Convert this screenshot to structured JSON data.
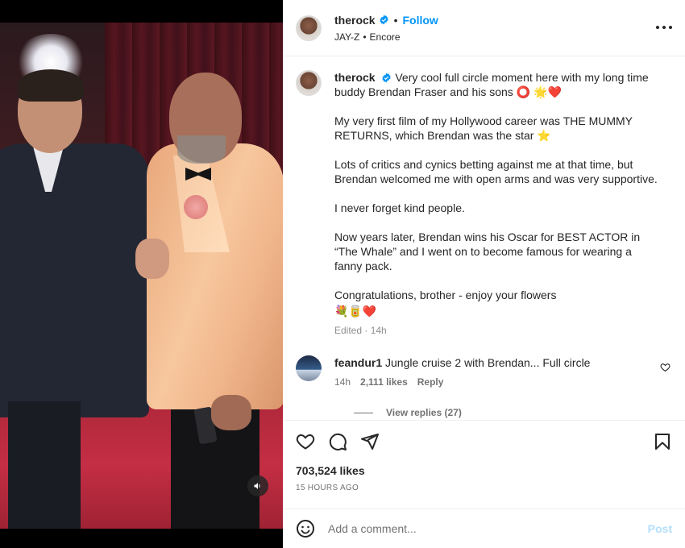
{
  "post": {
    "username": "therock",
    "follow_label": "Follow",
    "separator": "•",
    "music": {
      "artist": "JAY-Z",
      "track": "Encore"
    }
  },
  "caption": {
    "username": "therock",
    "paragraphs": [
      "Very cool full circle moment here with my long time buddy Brendan Fraser and his sons ⭕ 🌟❤️",
      "My very first film of my Hollywood career was THE MUMMY RETURNS, which Brendan was the star ⭐",
      "Lots of critics and cynics betting against me at that time, but Brendan welcomed me with open arms and was very supportive.",
      "I never forget kind people.",
      "Now years later, Brendan wins his Oscar for BEST ACTOR in “The Whale” and I went on to become famous for wearing a fanny pack.",
      "Congratulations, brother - enjoy your flowers",
      "💐🥫❤️"
    ],
    "meta": "Edited · 14h"
  },
  "comment": {
    "username": "feandur1",
    "text": "Jungle cruise 2 with Brendan... Full circle",
    "time": "14h",
    "likes": "2,111 likes",
    "reply_label": "Reply",
    "view_replies": "View replies (27)"
  },
  "engagement": {
    "likes": "703,524 likes",
    "posted": "15 HOURS AGO"
  },
  "composer": {
    "placeholder": "Add a comment...",
    "post_label": "Post"
  },
  "colors": {
    "accent": "#0095f6",
    "post_disabled": "#b2dffc",
    "secondary_text": "#737373"
  },
  "icons": [
    "verified-badge-icon",
    "music-note-icon",
    "more-options-icon",
    "heart-icon",
    "comment-icon",
    "share-icon",
    "save-icon",
    "emoji-icon",
    "sound-icon"
  ]
}
